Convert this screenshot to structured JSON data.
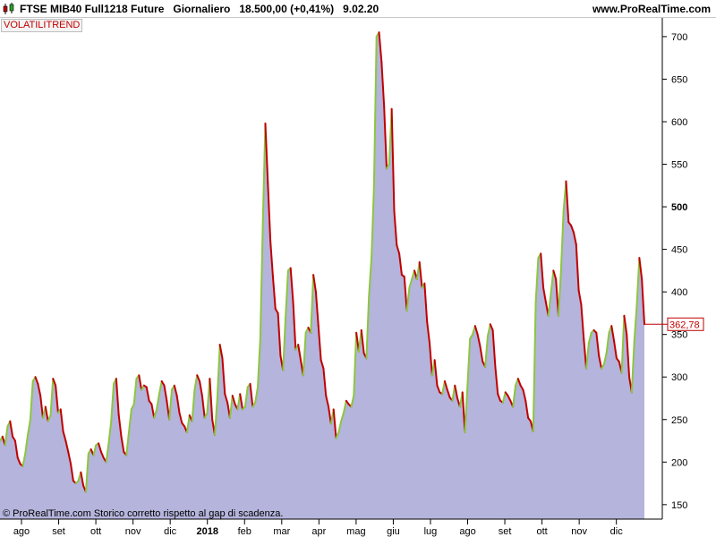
{
  "header": {
    "title": "FTSE MIB40 Full1218 Future   Giornaliero   18.500,00 (+0,41%)   9.02.20",
    "brand": "www.ProRealTime.com"
  },
  "indicator": {
    "label": "VOLATILITREND"
  },
  "footer": {
    "copyright": "© ProRealTime.com  Storico corretto rispetto al gap di scadenza."
  },
  "colors": {
    "fill": "#b4b4dc",
    "rising": "#8cc63f",
    "falling": "#c00000",
    "label": "#c00000"
  },
  "icons": {
    "candle": "candlestick-icon"
  },
  "chart_data": {
    "type": "area",
    "series": [
      {
        "values": [
          225,
          230,
          220,
          242,
          248,
          230,
          225,
          205,
          198,
          195,
          210,
          232,
          250,
          295,
          300,
          292,
          278,
          252,
          265,
          248,
          255,
          298,
          290,
          258,
          262,
          236,
          225,
          212,
          198,
          178,
          175,
          178,
          188,
          172,
          165,
          210,
          215,
          208,
          220,
          222,
          212,
          205,
          200,
          222,
          248,
          292,
          298,
          255,
          230,
          212,
          208,
          235,
          262,
          268,
          298,
          302,
          285,
          290,
          288,
          272,
          268,
          252,
          262,
          280,
          295,
          290,
          272,
          250,
          285,
          290,
          278,
          258,
          246,
          242,
          235,
          255,
          248,
          285,
          302,
          295,
          278,
          252,
          258,
          298,
          250,
          232,
          275,
          338,
          322,
          280,
          270,
          252,
          278,
          268,
          262,
          280,
          262,
          265,
          288,
          292,
          265,
          270,
          288,
          345,
          480,
          598,
          528,
          460,
          418,
          380,
          375,
          325,
          308,
          370,
          425,
          428,
          388,
          332,
          338,
          320,
          302,
          352,
          358,
          352,
          420,
          400,
          360,
          320,
          310,
          278,
          265,
          245,
          262,
          228,
          235,
          248,
          258,
          272,
          268,
          265,
          278,
          352,
          330,
          355,
          328,
          322,
          395,
          440,
          525,
          700,
          705,
          670,
          618,
          545,
          550,
          615,
          495,
          455,
          445,
          420,
          418,
          378,
          405,
          415,
          425,
          415,
          435,
          405,
          410,
          365,
          340,
          302,
          320,
          290,
          282,
          280,
          295,
          285,
          276,
          272,
          290,
          275,
          265,
          282,
          235,
          290,
          345,
          350,
          360,
          350,
          336,
          318,
          312,
          348,
          362,
          355,
          312,
          280,
          272,
          270,
          282,
          278,
          272,
          265,
          290,
          298,
          290,
          285,
          272,
          252,
          248,
          236,
          388,
          440,
          445,
          405,
          388,
          372,
          398,
          425,
          415,
          372,
          425,
          495,
          530,
          482,
          478,
          470,
          456,
          402,
          385,
          345,
          310,
          340,
          352,
          355,
          352,
          325,
          310,
          315,
          328,
          352,
          360,
          342,
          322,
          318,
          305,
          372,
          350,
          300,
          282,
          342,
          385,
          440,
          415,
          362
        ]
      }
    ],
    "x_ticks": [
      "ago",
      "set",
      "ott",
      "nov",
      "dic",
      "2018",
      "feb",
      "mar",
      "apr",
      "mag",
      "giu",
      "lug",
      "ago",
      "set",
      "ott",
      "nov",
      "dic"
    ],
    "y_ticks": [
      "150",
      "200",
      "250",
      "300",
      "350",
      "400",
      "450",
      "500",
      "550",
      "600",
      "650",
      "700"
    ],
    "last_value": "362,78",
    "ylim": [
      133,
      722
    ],
    "grid": false,
    "legend": "none"
  }
}
